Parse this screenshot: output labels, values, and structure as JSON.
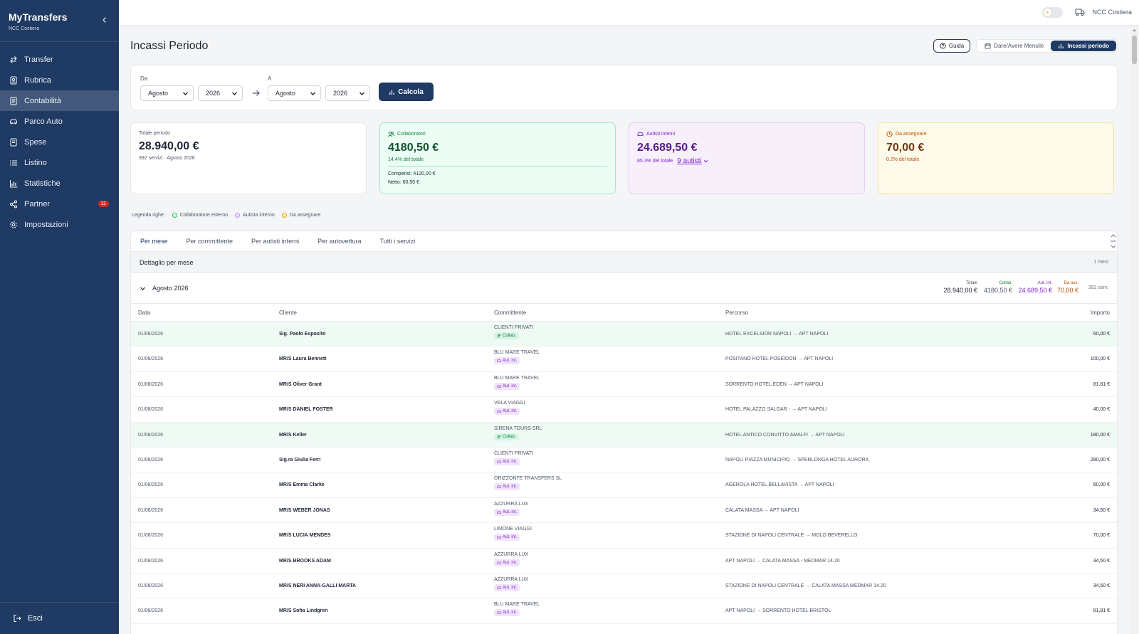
{
  "app": {
    "title": "MyTransfers",
    "subtitle": "NCC Costiera"
  },
  "sidebar": {
    "items": [
      {
        "label": "Transfer",
        "icon": "arrows-swap-icon"
      },
      {
        "label": "Rubrica",
        "icon": "contact-book-icon"
      },
      {
        "label": "Contabilità",
        "icon": "ledger-icon",
        "active": true
      },
      {
        "label": "Parco Auto",
        "icon": "car-icon"
      },
      {
        "label": "Spese",
        "icon": "receipt-icon"
      },
      {
        "label": "Listino",
        "icon": "list-icon"
      },
      {
        "label": "Statistiche",
        "icon": "bar-chart-icon"
      },
      {
        "label": "Partner",
        "icon": "share-icon",
        "badge": "11"
      },
      {
        "label": "Impostazioni",
        "icon": "gear-icon"
      }
    ],
    "logout": "Esci"
  },
  "topbar": {
    "company": "NCC Costiera",
    "theme_toggle": "light"
  },
  "page": {
    "title": "Incassi Periodo",
    "guide_label": "Guida",
    "seg_left": "Dare/Avere Mensile",
    "seg_right": "Incassi periodo"
  },
  "filters": {
    "from_label": "Da",
    "to_label": "A",
    "from_month": "Agosto",
    "from_year": "2026",
    "to_month": "Agosto",
    "to_year": "2026",
    "calc_label": "Calcola"
  },
  "stats": {
    "total": {
      "label": "Totale periodo",
      "value": "28.940,00 €",
      "sub": "392 servizi · Agosto 2026"
    },
    "collab": {
      "label": "Collaboratori",
      "value": "4180,50 €",
      "sub": "14.4% del totale",
      "compensi": "Compensi: 4120,00 €",
      "netto": "Netto: 60,50 €"
    },
    "interni": {
      "label": "Autisti interni",
      "value": "24.689,50 €",
      "sub": "85.3% del totale",
      "link": "9 autisti"
    },
    "assegnare": {
      "label": "Da assegnare",
      "value": "70,00 €",
      "sub": "0.2% del totale"
    }
  },
  "legend": {
    "title": "Legenda righe:",
    "items": [
      "Collaboratore esterno",
      "Autista interno",
      "Da assegnare"
    ]
  },
  "colors": {
    "sidebar": "#1f3a63",
    "green": "#15803d",
    "purple": "#7e22ce",
    "amber": "#b45309"
  },
  "tabs": [
    "Per mese",
    "Per committente",
    "Per autisti interni",
    "Per autovettura",
    "Tutti i servizi"
  ],
  "detail": {
    "title": "Dettaglio per mese",
    "count": "1 mesi"
  },
  "month": {
    "name": "Agosto 2026",
    "totale_k": "Totale",
    "totale_v": "28.940,00 €",
    "collab_k": "Collab.",
    "collab_v": "4180,50 €",
    "aut_k": "Aut. int.",
    "aut_v": "24.689,50 €",
    "ass_k": "Da ass.",
    "ass_v": "70,00 €",
    "services": "392 serv."
  },
  "table": {
    "headers": {
      "date": "Data",
      "client": "Cliente",
      "comm": "Committente",
      "route": "Percorso",
      "amount": "Importo"
    },
    "rows": [
      {
        "date": "01/08/2026",
        "client": "Sig. Paolo Esposito",
        "comm": "CLIENTI PRIVATI",
        "tag": "Collab.",
        "route": "HOTEL EXCELSIOR NAPOLI → APT NAPOLI",
        "amount": "60,00 €"
      },
      {
        "date": "01/08/2026",
        "client": "MR/S Laura Bennett",
        "comm": "BLU MARE TRAVEL",
        "tag": "Aut. int.",
        "route": "POSITANO HOTEL POSEIDON → APT NAPOLI",
        "amount": "100,00 €"
      },
      {
        "date": "01/08/2026",
        "client": "MR/S Oliver Grant",
        "comm": "BLU MARE TRAVEL",
        "tag": "Aut. int.",
        "route": "SORRENTO HOTEL EDEN → APT NAPOLI",
        "amount": "81,81 €"
      },
      {
        "date": "01/08/2026",
        "client": "MR/S DANIEL FOSTER",
        "comm": "VELA VIAGGI",
        "tag": "Aut. int.",
        "route": "HOTEL PALAZZO SALGAR - → APT NAPOLI",
        "amount": "40,00 €"
      },
      {
        "date": "01/08/2026",
        "client": "MR/S Keller",
        "comm": "SIRENA TOURS SRL",
        "tag": "Collab.",
        "route": "HOTEL ANTICO CONVITTO AMALFI → APT NAPOLI",
        "amount": "180,00 €"
      },
      {
        "date": "01/08/2026",
        "client": "Sig.ra Giulia Ferri",
        "comm": "CLIENTI PRIVATI",
        "tag": "Aut. int.",
        "route": "NAPOLI PIAZZA MUNICIPIO → SPERLONGA HOTEL AURORA",
        "amount": "280,00 €"
      },
      {
        "date": "01/08/2026",
        "client": "MR/S Emma Clarke",
        "comm": "ORIZZONTE TRANSFERS SL",
        "tag": "Aut. int.",
        "route": "AGEROLA HOTEL BELLAVISTA → APT NAPOLI",
        "amount": "60,00 €"
      },
      {
        "date": "01/08/2026",
        "client": "MR/S WEBER JONAS",
        "comm": "AZZURRA LUX",
        "tag": "Aut. int.",
        "route": "CALATA MASSA → APT NAPOLI",
        "amount": "34,50 €"
      },
      {
        "date": "01/08/2026",
        "client": "MR/S LUCIA MENDES",
        "comm": "LIMONE VIAGGI",
        "tag": "Aut. int.",
        "route": "STAZIONE DI NAPOLI CENTRALE → MOLO BEVERELLO",
        "amount": "70,00 €"
      },
      {
        "date": "01/08/2026",
        "client": "MR/S BROOKS ADAM",
        "comm": "AZZURRA LUX",
        "tag": "Aut. int.",
        "route": "APT NAPOLI → CALATA MASSA - MEDMAR 14.20",
        "amount": "34,50 €"
      },
      {
        "date": "01/08/2026",
        "client": "MR/S NERI ANNA-GALLI MARTA",
        "comm": "AZZURRA LUX",
        "tag": "Aut. int.",
        "route": "STAZIONE DI NAPOLI CENTRALE → CALATA MASSA MEDMAR 14.20",
        "amount": "34,50 €"
      },
      {
        "date": "01/08/2026",
        "client": "MR/S Sofia Lindgren",
        "comm": "BLU MARE TRAVEL",
        "tag": "Aut. int.",
        "route": "APT NAPOLI → SORRENTO HOTEL BRISTOL",
        "amount": "81,81 €"
      }
    ]
  }
}
